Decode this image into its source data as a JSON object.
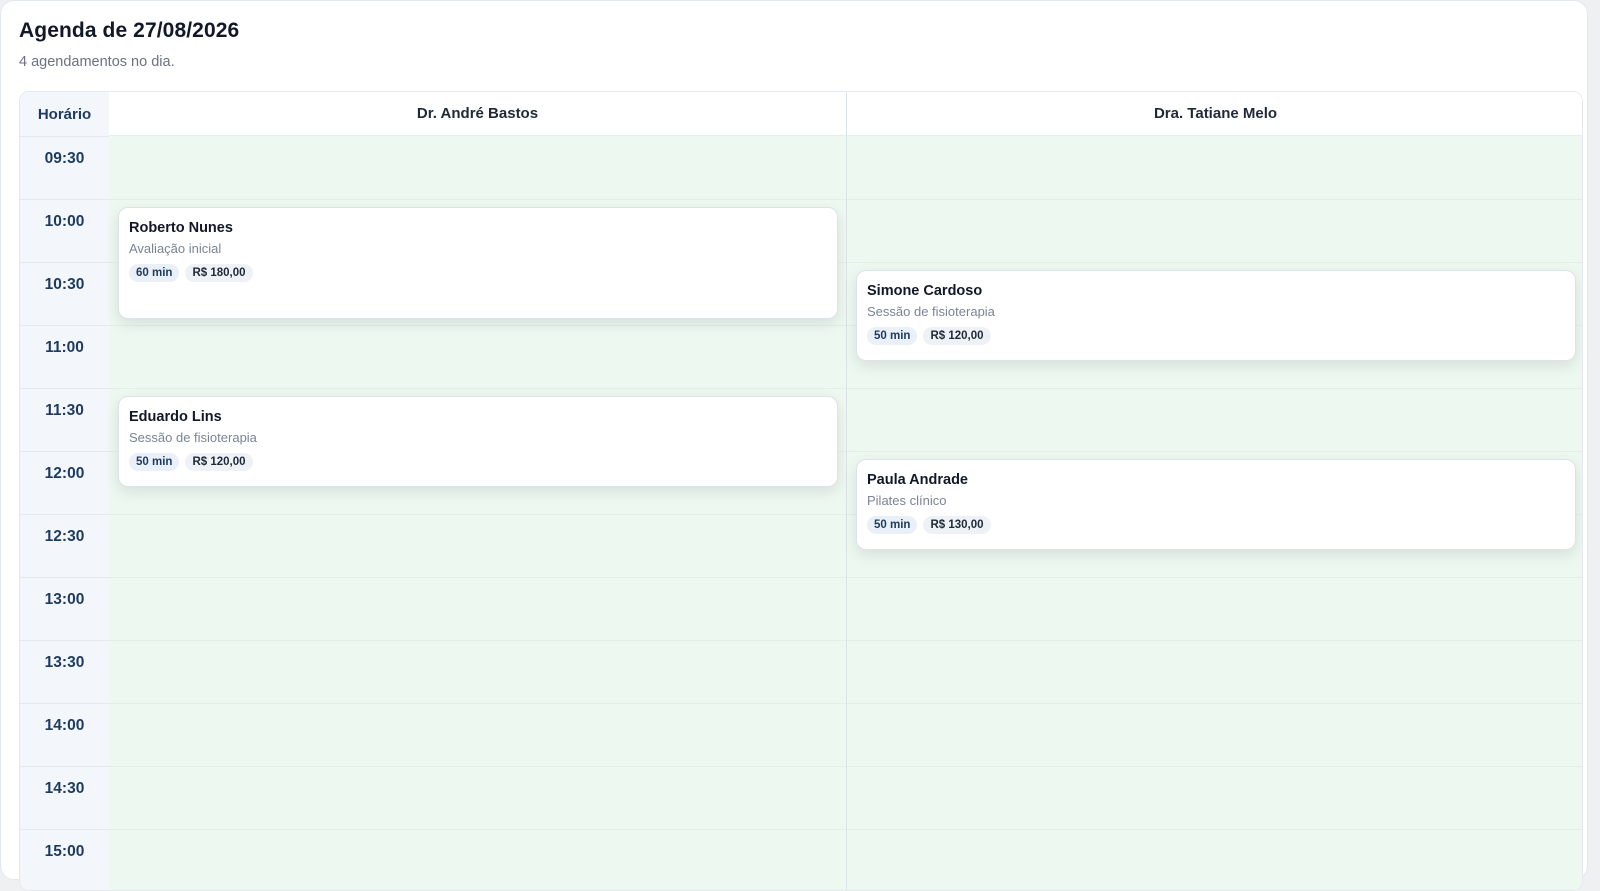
{
  "header": {
    "title": "Agenda de 27/08/2026",
    "subtitle": "4 agendamentos no dia."
  },
  "grid": {
    "time_header": "Horário",
    "slots": [
      "09:30",
      "10:00",
      "10:30",
      "11:00",
      "11:30",
      "12:00",
      "12:30",
      "13:00",
      "13:30",
      "14:00",
      "14:30",
      "15:00"
    ],
    "professionals": [
      {
        "name": "Dr. André Bastos",
        "appointments": [
          {
            "patient": "Roberto Nunes",
            "service": "Avaliação inicial",
            "duration": "60 min",
            "price": "R$ 180,00",
            "start": "10:00"
          },
          {
            "patient": "Eduardo Lins",
            "service": "Sessão de fisioterapia",
            "duration": "50 min",
            "price": "R$ 120,00",
            "start": "11:30"
          }
        ]
      },
      {
        "name": "Dra. Tatiane Melo",
        "appointments": [
          {
            "patient": "Simone Cardoso",
            "service": "Sessão de fisioterapia",
            "duration": "50 min",
            "price": "R$ 120,00",
            "start": "10:30"
          },
          {
            "patient": "Paula Andrade",
            "service": "Pilates clínico",
            "duration": "50 min",
            "price": "R$ 130,00",
            "start": "12:00"
          }
        ]
      }
    ]
  },
  "colors": {
    "free_slot": "#edf8f0",
    "time_column": "#f3f7fb",
    "time_text": "#1e3a5f",
    "card": "#ffffff"
  }
}
